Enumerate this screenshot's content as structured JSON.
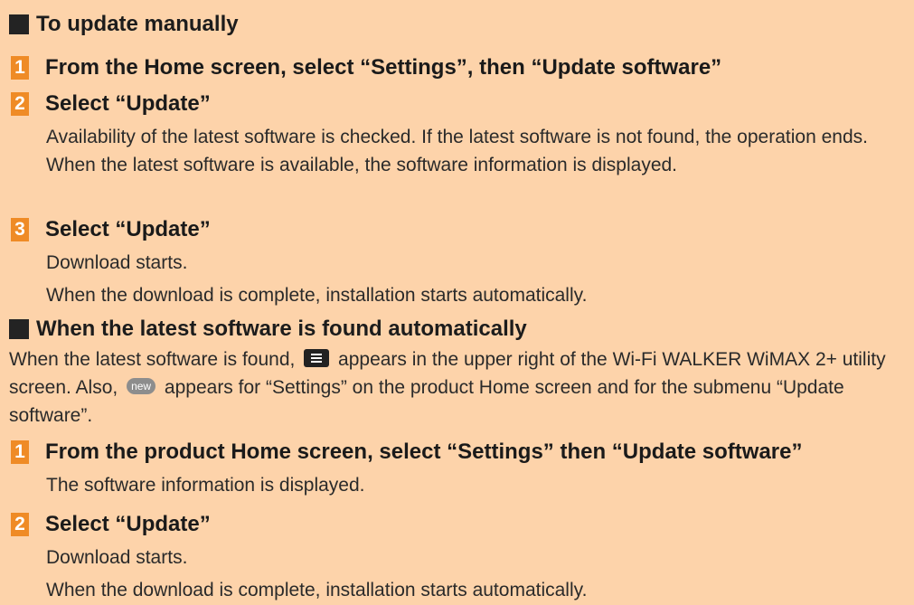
{
  "section1": {
    "title": "To update manually",
    "steps": [
      {
        "number": "1",
        "title": "From the Home screen, select “Settings”, then “Update software”",
        "body": []
      },
      {
        "number": "2",
        "title": "Select “Update”",
        "body": [
          "Availability of the latest software is checked. If the latest software is not found, the operation ends. When the latest software is available, the software information is displayed."
        ]
      },
      {
        "number": "3",
        "title": "Select “Update”",
        "body": [
          "Download starts.",
          "When the download is complete, installation starts automatically."
        ]
      }
    ]
  },
  "section2": {
    "title": "When the latest software is found automatically",
    "intro": {
      "part1": "When the latest software is found,",
      "part2": "appears in the upper right of the Wi-Fi WALKER WiMAX 2+ utility screen. Also,",
      "new_badge": "new",
      "part3": "appears for “Settings” on the product Home screen and for the submenu “Update software”."
    },
    "steps": [
      {
        "number": "1",
        "title": "From the product Home screen, select “Settings” then “Update software”",
        "body": [
          "The software information is displayed."
        ]
      },
      {
        "number": "2",
        "title": "Select “Update”",
        "body": [
          "Download starts.",
          "When the download is complete, installation starts automatically."
        ]
      }
    ]
  },
  "colors": {
    "background": "#fdd3aa",
    "step_badge": "#ef8b26",
    "heading_square": "#232323"
  }
}
